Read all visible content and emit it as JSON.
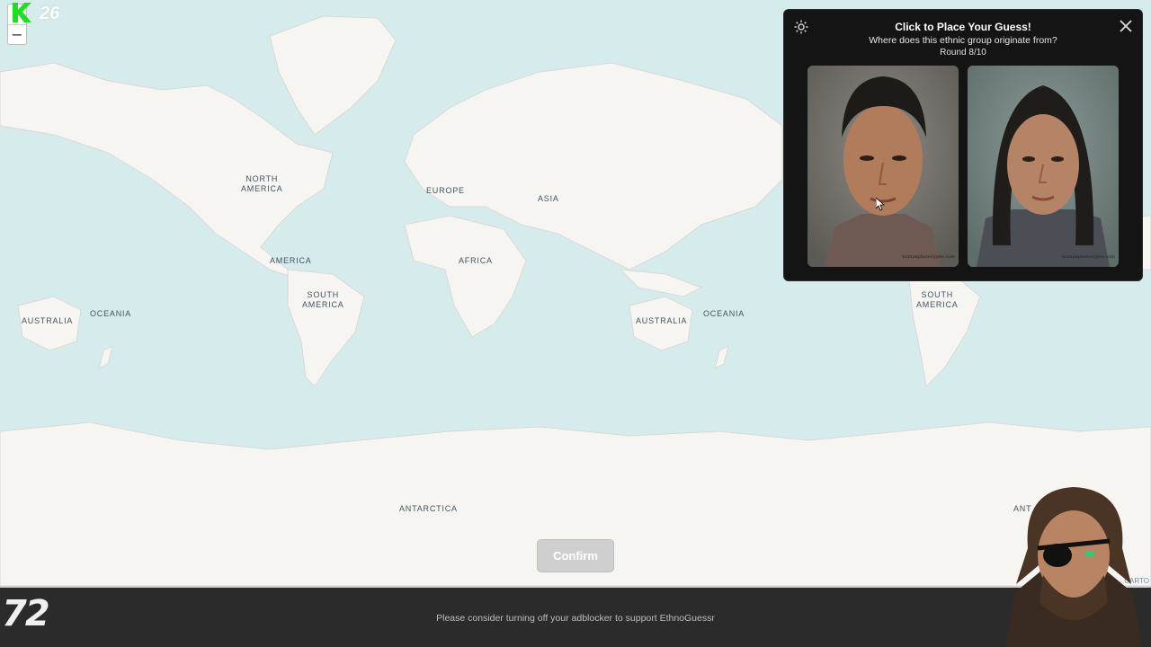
{
  "app": {
    "streak_count": "26",
    "zoom_in": "+",
    "zoom_out": "−"
  },
  "map": {
    "labels": {
      "north_america": "NORTH\nAMERICA",
      "america": "AMERICA",
      "south_america_left": "SOUTH\nAMERICA",
      "europe": "EUROPE",
      "asia": "ASIA",
      "africa": "AFRICA",
      "australia_left": "AUSTRALIA",
      "oceania_left": "OCEANIA",
      "australia_right": "AUSTRALIA",
      "oceania_right": "OCEANIA",
      "south_america_right": "SOUTH\nAMERICA",
      "antarctica": "ANTARCTICA",
      "antarctica_right_partial": "ANT"
    },
    "attribution": "CARTO"
  },
  "panel": {
    "title": "Click to Place Your Guess!",
    "question": "Where does this ethnic group originate from?",
    "round": "Round 8/10",
    "photos": [
      {
        "watermark": "humanphenotypes.com"
      },
      {
        "watermark": "humanphenotypes.com"
      }
    ]
  },
  "confirm_label": "Confirm",
  "footer": {
    "message": "Please consider turning off your adblocker to support EthnoGuessr",
    "badge": "72"
  },
  "colors": {
    "ocean": "#d6ecec",
    "land": "#f6f5f1",
    "panel_bg": "#141414",
    "streak_green": "#22dd22",
    "footer_bg": "#2b2b2b"
  }
}
